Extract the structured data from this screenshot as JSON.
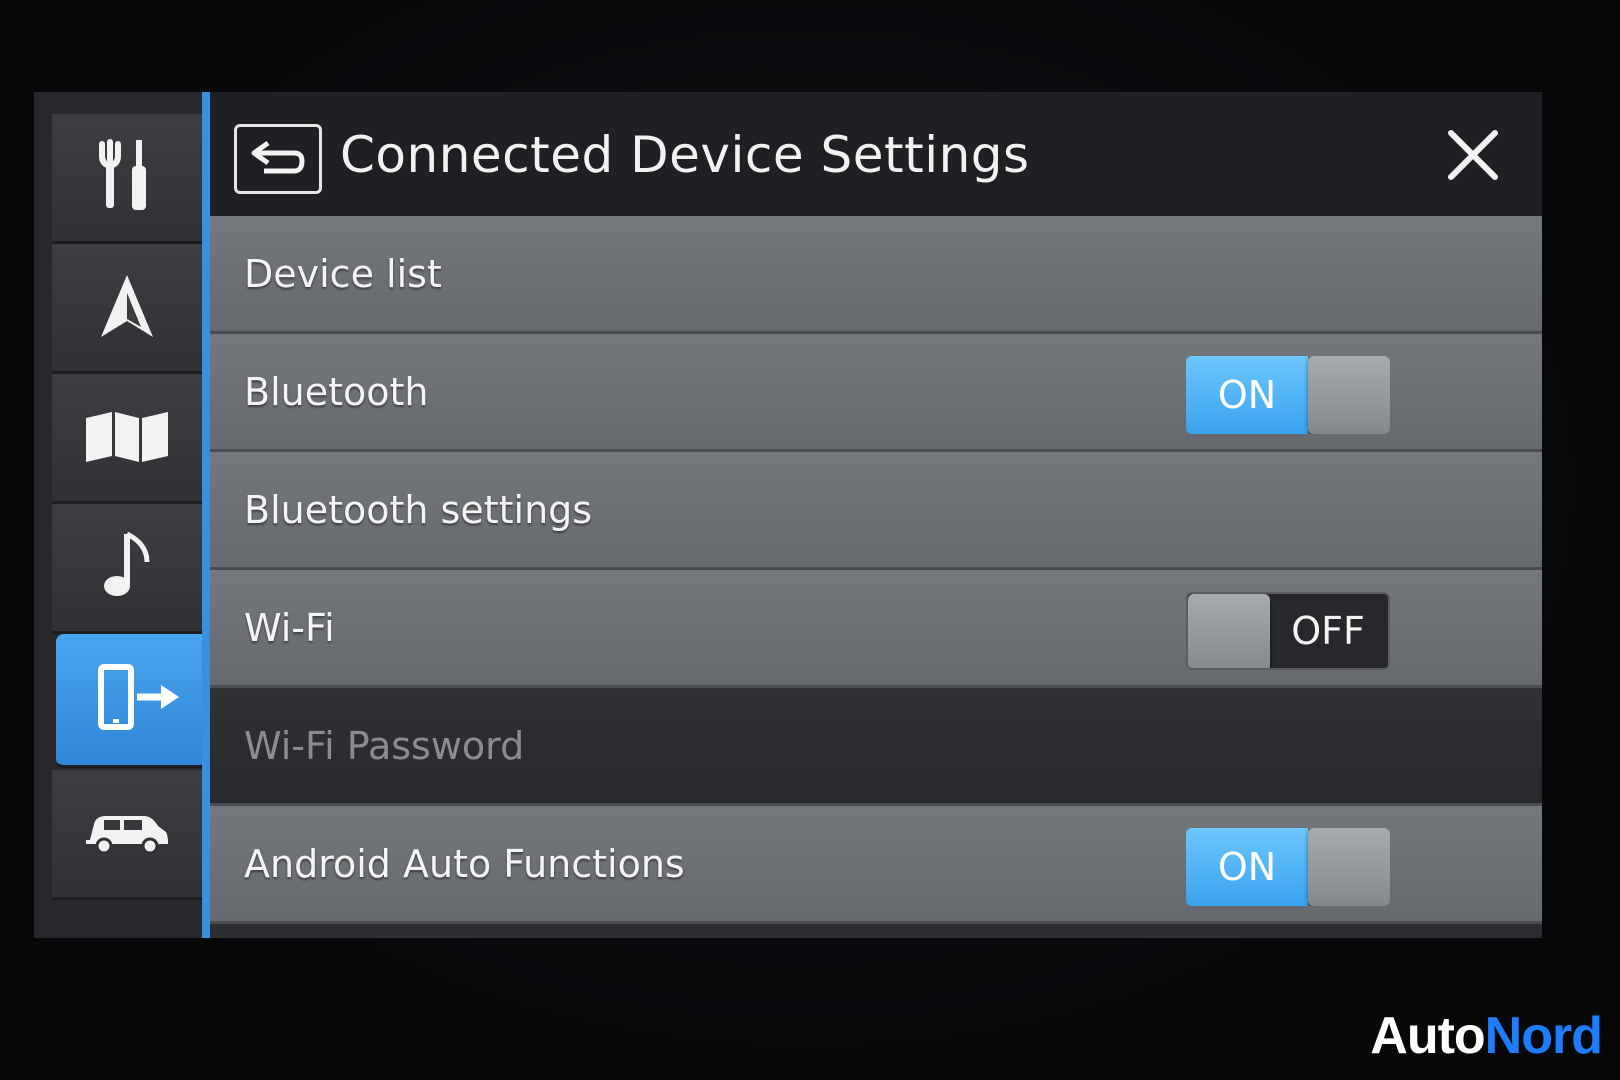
{
  "header": {
    "title": "Connected Device Settings"
  },
  "rail": {
    "items": [
      {
        "icon": "tools-icon"
      },
      {
        "icon": "navigation-arrow-icon"
      },
      {
        "icon": "map-icon"
      },
      {
        "icon": "music-note-icon"
      },
      {
        "icon": "connected-device-icon",
        "active": true
      },
      {
        "icon": "car-icon"
      }
    ]
  },
  "settings": {
    "rows": [
      {
        "label": "Device list"
      },
      {
        "label": "Bluetooth",
        "toggle": "ON"
      },
      {
        "label": "Bluetooth settings"
      },
      {
        "label": "Wi-Fi",
        "toggle": "OFF"
      },
      {
        "label": "Wi-Fi Password",
        "disabled": true
      },
      {
        "label": "Android Auto Functions",
        "toggle": "ON"
      }
    ]
  },
  "watermark": {
    "part1": "Auto",
    "part2": "Nord"
  },
  "colors": {
    "accent": "#3b8fe0",
    "toggle_on": "#4fb3f7",
    "row_bg": "#6f7277",
    "header_bg": "#1f2023"
  }
}
